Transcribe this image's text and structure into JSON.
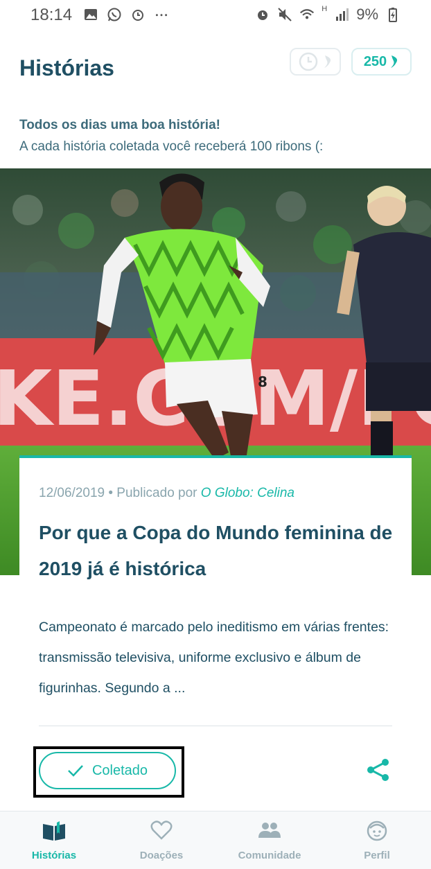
{
  "status_bar": {
    "time": "18:14",
    "network": "H",
    "battery": "9%"
  },
  "header": {
    "title": "Histórias",
    "ribbons_count": "250"
  },
  "intro": {
    "headline": "Todos os dias uma boa história!",
    "subtitle": "A cada história coletada você receberá 100 ribons (:"
  },
  "hero": {
    "banner_text": "KE.COM/FOO",
    "jersey_number": "8"
  },
  "story": {
    "date": "12/06/2019",
    "published_by": "• Publicado por",
    "author": "O Globo: Celina",
    "title": "Por que a Copa do Mundo feminina de 2019 já é histórica",
    "excerpt": "Campeonato é marcado pelo ineditismo em várias frentes: transmissão televisiva, uniforme exclusivo e álbum de figurinhas. Segundo a ...",
    "collected_label": "Coletado"
  },
  "bottom_nav": {
    "items": [
      {
        "label": "Histórias",
        "icon": "book-icon",
        "active": true
      },
      {
        "label": "Doações",
        "icon": "heart-icon",
        "active": false
      },
      {
        "label": "Comunidade",
        "icon": "people-icon",
        "active": false
      },
      {
        "label": "Perfil",
        "icon": "face-icon",
        "active": false
      }
    ]
  },
  "colors": {
    "accent": "#18b8a8",
    "title": "#1f4f63",
    "muted": "#8aa5ae"
  }
}
